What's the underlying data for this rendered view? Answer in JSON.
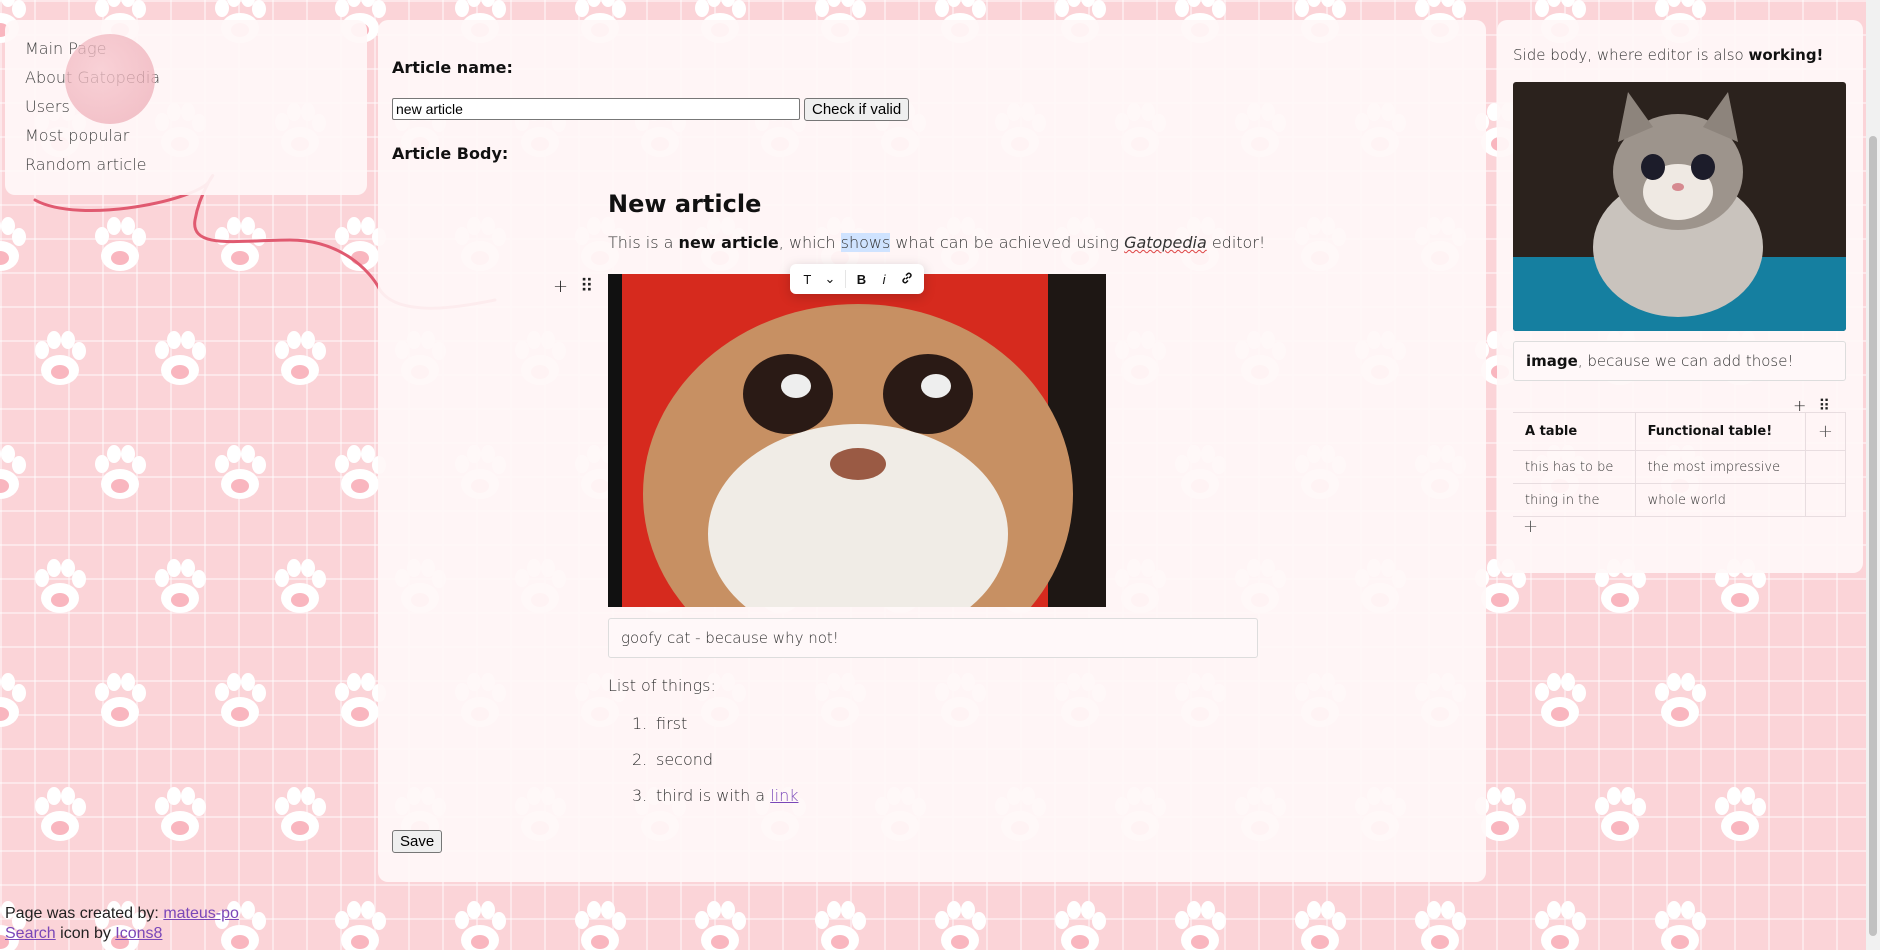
{
  "nav": {
    "items": [
      {
        "label": "Main Page"
      },
      {
        "label": "About Gatopedia"
      },
      {
        "label": "Users"
      },
      {
        "label": "Most popular"
      },
      {
        "label": "Random article"
      }
    ]
  },
  "form": {
    "article_name_label": "Article name:",
    "article_name_value": "new article",
    "check_button": "Check if valid",
    "article_body_label": "Article Body:",
    "save_button": "Save"
  },
  "editor": {
    "heading": "New article",
    "para": {
      "t1": "This is a ",
      "bold": "new article",
      "t2": ", which ",
      "selected": "shows",
      "t3": " what can be achieved using ",
      "italic": "Gatopedia",
      "t4": " editor!"
    },
    "image_caption": "goofy cat - because why not!",
    "list_title": "List of things:",
    "list": [
      {
        "num": "1.",
        "text": "first"
      },
      {
        "num": "2.",
        "text": "second"
      },
      {
        "num": "3.",
        "text": "third is with a "
      }
    ],
    "list_link": "link",
    "toolbar": {
      "text_icon": "T",
      "bold_icon": "B",
      "italic_icon": "i"
    }
  },
  "side": {
    "text_plain": "Side body, where editor is also ",
    "text_bold": "working!",
    "caption_bold": "image",
    "caption_rest": ", because we can add those!",
    "table": {
      "headers": [
        "A table",
        "Functional table!"
      ],
      "rows": [
        [
          "this has to be",
          "the most impressive"
        ],
        [
          "thing in the",
          "whole world"
        ]
      ]
    }
  },
  "footer": {
    "created_text": "Page was created by: ",
    "author_link": "mateus-po",
    "search_link": "Search",
    "icon_by_text": " icon by ",
    "icons8_link": "Icons8"
  },
  "colors": {
    "background": "#fbd4d8",
    "panel": "#fff7f8",
    "link": "#7a47b8",
    "yarn_thread": "#e05a70"
  }
}
